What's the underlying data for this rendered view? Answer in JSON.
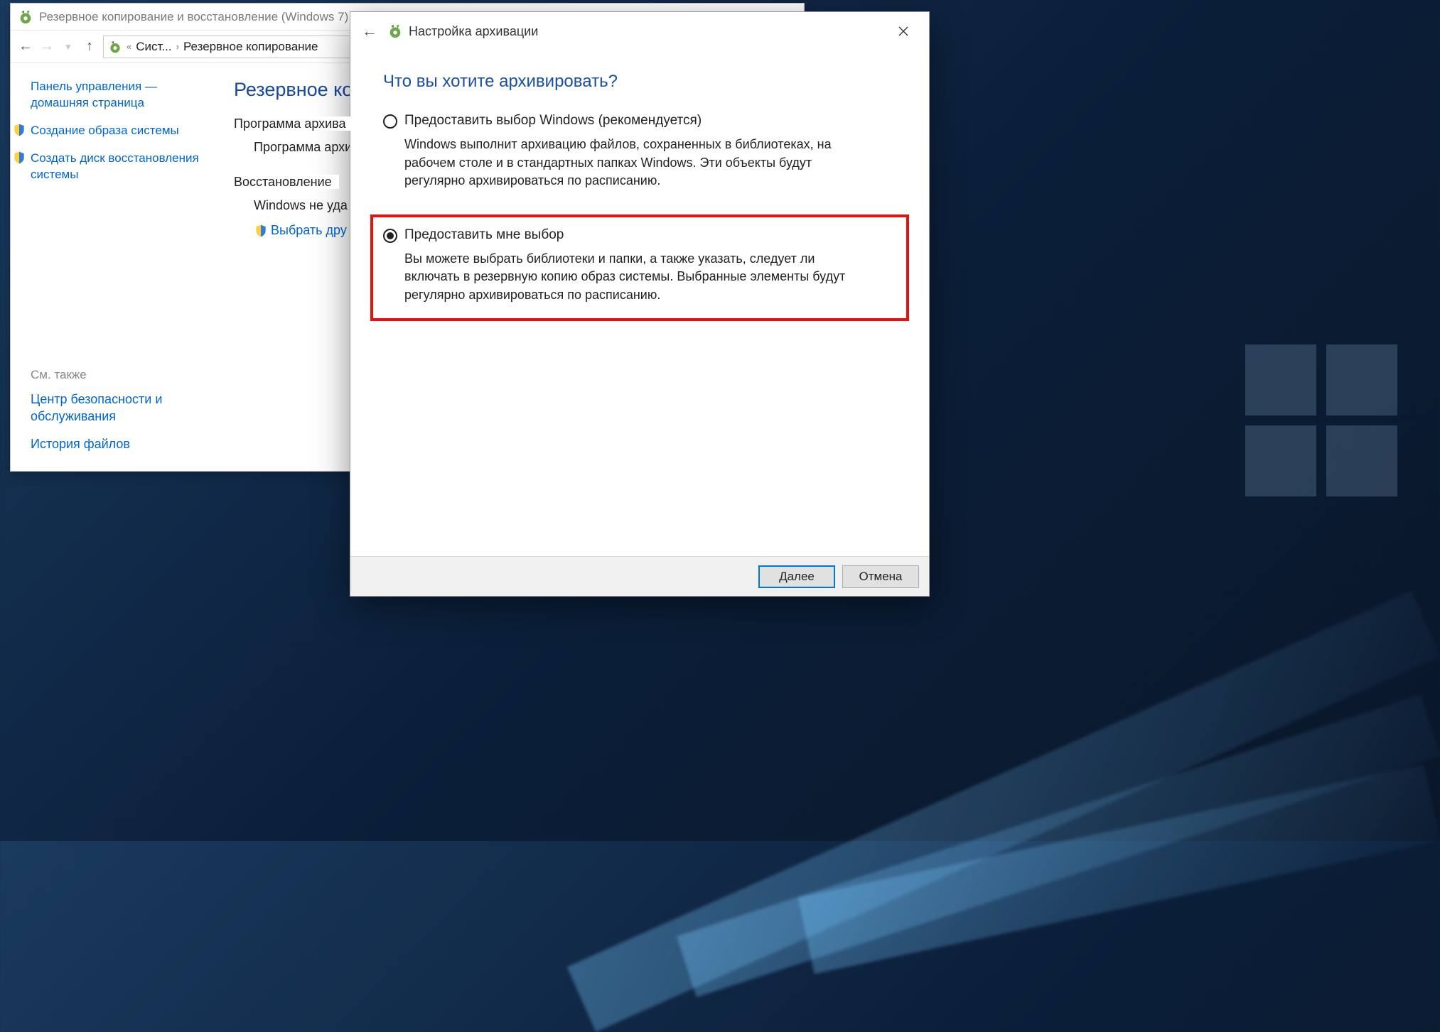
{
  "back_window": {
    "title": "Резервное копирование и восстановление (Windows 7)",
    "breadcrumbs": {
      "p1": "Сист...",
      "p2": "Резервное копирование"
    },
    "side": {
      "home": "Панель управления — домашняя страница",
      "create_image": "Создание образа системы",
      "create_disk": "Создать диск восстановления системы"
    },
    "main": {
      "heading": "Резервное коп",
      "section1": "Программа архива",
      "sub1": "Программа архи",
      "section2": "Восстановление",
      "sub2": "Windows не уда",
      "link": "Выбрать дру"
    },
    "also": {
      "header": "См. также",
      "l1": "Центр безопасности и обслуживания",
      "l2": "История файлов"
    }
  },
  "front_window": {
    "title": "Настройка архивации",
    "heading": "Что вы хотите архивировать?",
    "opt1": {
      "label": "Предоставить выбор Windows (рекомендуется)",
      "desc": "Windows выполнит архивацию файлов, сохраненных в библиотеках, на рабочем столе и в стандартных папках Windows. Эти объекты будут регулярно архивироваться по расписанию."
    },
    "opt2": {
      "label": "Предоставить мне выбор",
      "desc": "Вы можете выбрать библиотеки и папки, а также указать, следует ли включать в резервную копию образ системы. Выбранные элементы будут регулярно архивироваться по расписанию."
    },
    "buttons": {
      "next": "Далее",
      "cancel": "Отмена"
    }
  }
}
